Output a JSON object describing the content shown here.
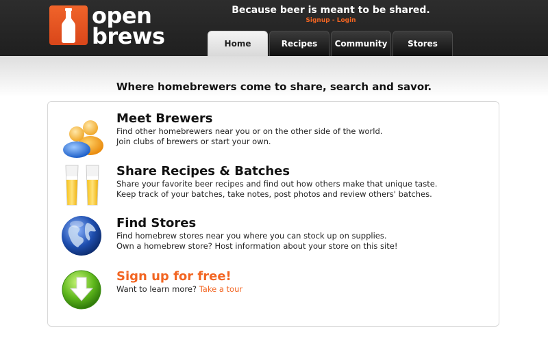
{
  "header": {
    "logo_line1": "open",
    "logo_line2": "brews",
    "tagline": "Because beer is meant to be shared.",
    "signup": "Signup",
    "separator": "-",
    "login": "Login"
  },
  "nav": {
    "tabs": [
      {
        "label": "Home",
        "active": true
      },
      {
        "label": "Recipes",
        "active": false
      },
      {
        "label": "Community",
        "active": false
      },
      {
        "label": "Stores",
        "active": false
      }
    ]
  },
  "main": {
    "headline": "Where homebrewers come to share, search and savor.",
    "features": [
      {
        "icon": "users-icon",
        "title": "Meet Brewers",
        "lines": [
          "Find other homebrewers near you or on the other side of the world.",
          "Join clubs of brewers or start your own."
        ]
      },
      {
        "icon": "beer-glasses-icon",
        "title": "Share Recipes & Batches",
        "lines": [
          "Share your favorite beer recipes and find out how others make that unique taste.",
          "Keep track of your batches, take notes, post photos and review others' batches."
        ]
      },
      {
        "icon": "globe-icon",
        "title": "Find Stores",
        "lines": [
          "Find homebrew stores near you where you can stock up on supplies.",
          "Own a homebrew store? Host information about your store on this site!"
        ]
      },
      {
        "icon": "download-arrow-icon",
        "title": "Sign up for free!",
        "text": "Want to learn more?",
        "link": "Take a tour"
      }
    ]
  },
  "colors": {
    "accent": "#f26522",
    "header_bg": "#262626"
  }
}
